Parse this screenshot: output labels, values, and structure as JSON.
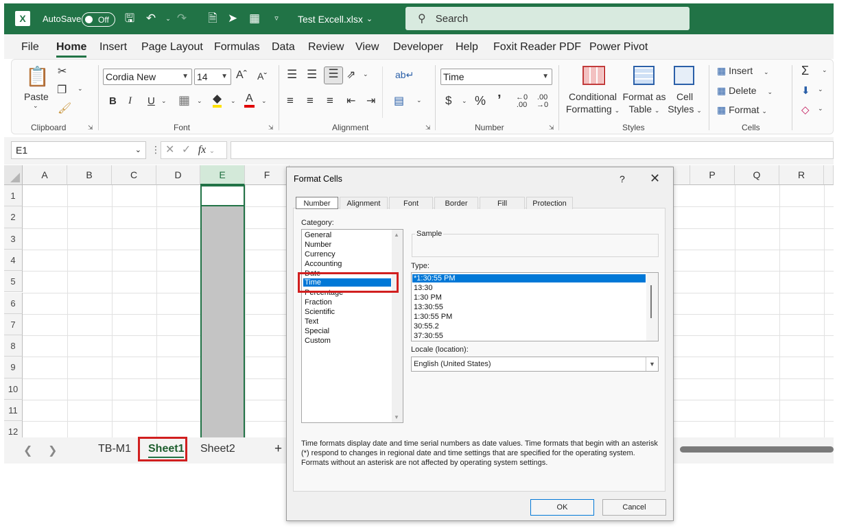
{
  "titlebar": {
    "autosave_label": "AutoSave",
    "autosave_state": "Off",
    "file_name": "Test Excell.xlsx",
    "search_placeholder": "Search"
  },
  "menu": {
    "tabs": [
      "File",
      "Home",
      "Insert",
      "Page Layout",
      "Formulas",
      "Data",
      "Review",
      "View",
      "Developer",
      "Help",
      "Foxit Reader PDF",
      "Power Pivot"
    ],
    "active": "Home"
  },
  "ribbon": {
    "clipboard": {
      "label": "Clipboard",
      "paste": "Paste"
    },
    "font": {
      "label": "Font",
      "name": "Cordia New",
      "size": "14",
      "bold": "B",
      "italic": "I",
      "underline": "U"
    },
    "alignment": {
      "label": "Alignment"
    },
    "number": {
      "label": "Number",
      "format": "Time",
      "currency": "$",
      "percent": "%"
    },
    "styles": {
      "label": "Styles",
      "conditional_1": "Conditional",
      "conditional_2": "Formatting",
      "format_table_1": "Format as",
      "format_table_2": "Table",
      "cell_styles_1": "Cell",
      "cell_styles_2": "Styles"
    },
    "cells": {
      "label": "Cells",
      "insert": "Insert",
      "delete": "Delete",
      "format": "Format"
    }
  },
  "formula_bar": {
    "name_box": "E1",
    "fx": "fx"
  },
  "grid": {
    "columns": [
      "A",
      "B",
      "C",
      "D",
      "E",
      "F",
      "P",
      "Q",
      "R"
    ],
    "rows": [
      "1",
      "2",
      "3",
      "4",
      "5",
      "6",
      "7",
      "8",
      "9",
      "10",
      "11",
      "12"
    ],
    "selected_column": "E"
  },
  "sheets": {
    "tabs": [
      "TB-M1",
      "Sheet1",
      "Sheet2"
    ],
    "active": "Sheet1",
    "add": "+"
  },
  "dialog": {
    "title": "Format Cells",
    "help": "?",
    "close": "✕",
    "tabs": [
      "Number",
      "Alignment",
      "Font",
      "Border",
      "Fill",
      "Protection"
    ],
    "active_tab": "Number",
    "category_label": "Category:",
    "categories": [
      "General",
      "Number",
      "Currency",
      "Accounting",
      "Date",
      "Time",
      "Percentage",
      "Fraction",
      "Scientific",
      "Text",
      "Special",
      "Custom"
    ],
    "selected_category": "Time",
    "sample_label": "Sample",
    "type_label": "Type:",
    "types": [
      "*1:30:55 PM",
      "13:30",
      "1:30 PM",
      "13:30:55",
      "1:30:55 PM",
      "30:55.2",
      "37:30:55"
    ],
    "selected_type": "*1:30:55 PM",
    "locale_label": "Locale (location):",
    "locale_value": "English (United States)",
    "description": "Time formats display date and time serial numbers as date values.  Time formats that begin with an asterisk (*) respond to changes in regional date and time settings that are specified for the operating system. Formats without an asterisk are not affected by operating system settings.",
    "ok": "OK",
    "cancel": "Cancel"
  },
  "colors": {
    "excel_green": "#217346",
    "selection_blue": "#0078d7",
    "highlight_red": "#d11f1f"
  }
}
